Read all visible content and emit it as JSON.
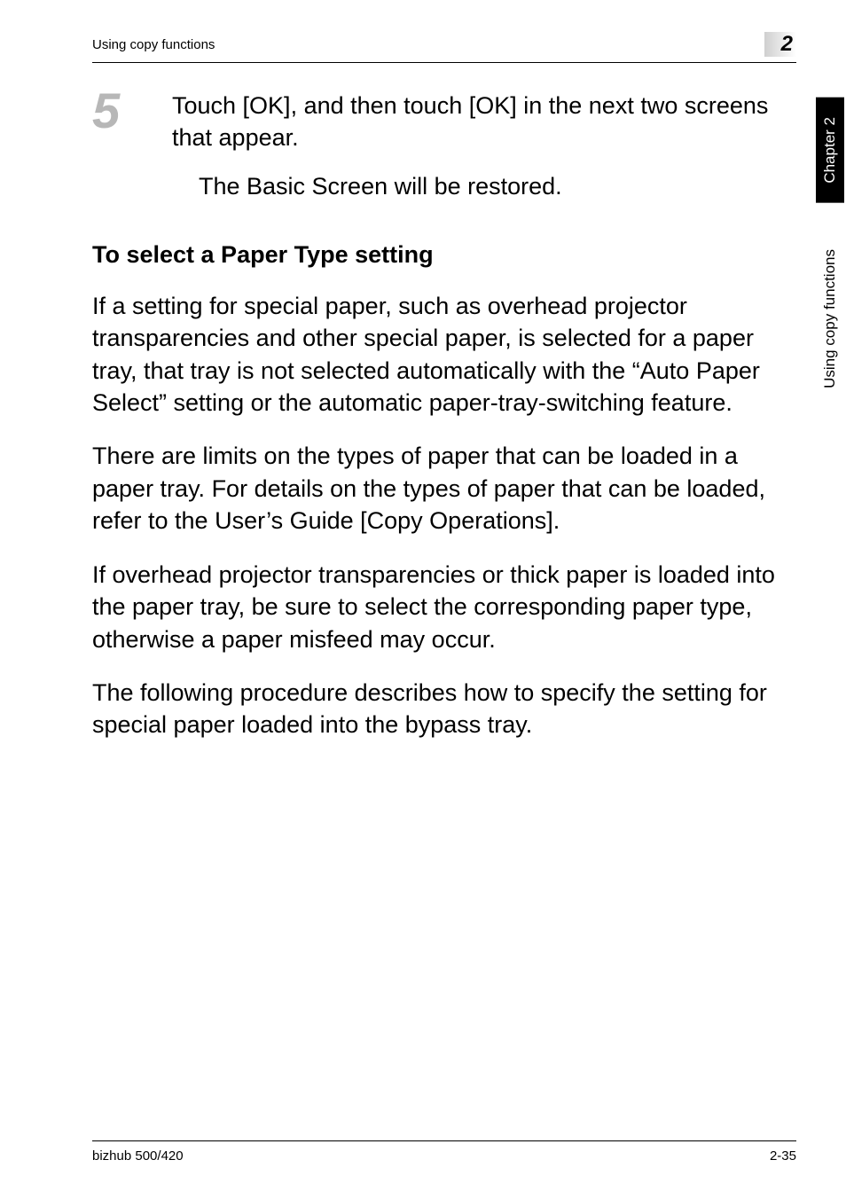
{
  "header": {
    "left": "Using copy functions",
    "chapnum": "2"
  },
  "step": {
    "number": "5",
    "text": "Touch [OK], and then touch [OK] in the next two screens that appear.",
    "follow": "The Basic Screen will be restored."
  },
  "section_heading": "To select a Paper Type setting",
  "paragraphs": {
    "p1": "If a setting for special paper, such as overhead projector transparencies and other special paper, is selected for a paper tray, that tray is not selected automatically with the “Auto Paper Select” setting or the automatic paper-tray-switching feature.",
    "p2": "There are limits on the types of paper that can be loaded in a paper tray. For details on the types of paper that can be loaded, refer to the User’s Guide [Copy Operations].",
    "p3": "If overhead projector transparencies or thick paper is loaded into the paper tray, be sure to select the corresponding paper type, otherwise a paper misfeed may occur.",
    "p4": "The following procedure describes how to specify the setting for special paper loaded into the bypass tray."
  },
  "sidetab": {
    "black": "Chapter 2",
    "white": "Using copy functions"
  },
  "footer": {
    "left": "bizhub 500/420",
    "right": "2-35"
  }
}
